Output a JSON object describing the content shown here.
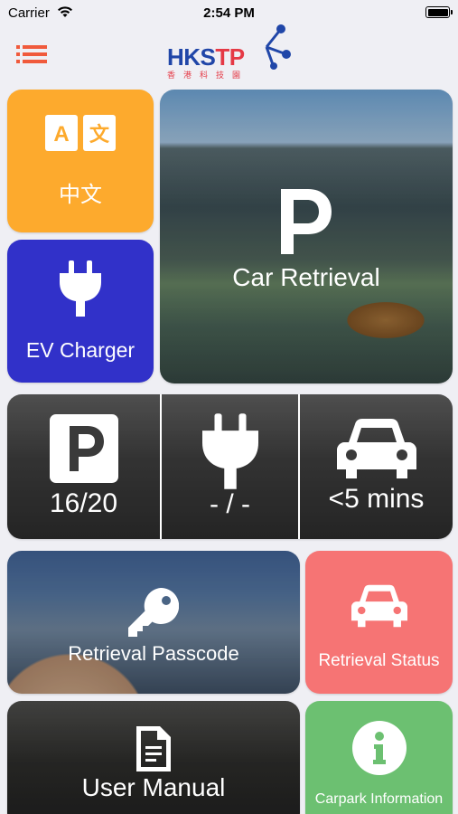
{
  "status_bar": {
    "carrier": "Carrier",
    "time": "2:54 PM",
    "wifi_icon": "wifi-icon",
    "battery_icon": "battery-icon"
  },
  "header": {
    "menu_icon": "list-menu-icon",
    "logo": {
      "wordmark_a": "HKS",
      "wordmark_b": "TP",
      "subtitle": "香港科技園"
    },
    "colors": {
      "menu": "#f05a3c",
      "logo_blue": "#2046a8",
      "logo_red": "#e53945"
    }
  },
  "tiles": {
    "language": {
      "label": "中文",
      "icon": "translate-icon",
      "color": "#fdaa2d"
    },
    "ev_charger": {
      "label": "EV Charger",
      "icon": "plug-icon",
      "color": "#3131c9"
    },
    "car_retrieval": {
      "label": "Car Retrieval",
      "icon": "parking-p-icon"
    },
    "stats": {
      "parking": {
        "value": "16/20",
        "icon": "parking-p-icon"
      },
      "charging": {
        "value": "- / -",
        "icon": "plug-icon"
      },
      "wait": {
        "value": "<5 mins",
        "icon": "car-icon"
      }
    },
    "retrieval_passcode": {
      "label": "Retrieval Passcode",
      "icon": "key-icon"
    },
    "retrieval_status": {
      "label": "Retrieval Status",
      "icon": "car-icon",
      "color": "#f67474"
    },
    "user_manual": {
      "label": "User Manual",
      "icon": "document-icon"
    },
    "carpark_information": {
      "label": "Carpark Information",
      "icon": "info-icon",
      "color": "#6cc071"
    }
  }
}
